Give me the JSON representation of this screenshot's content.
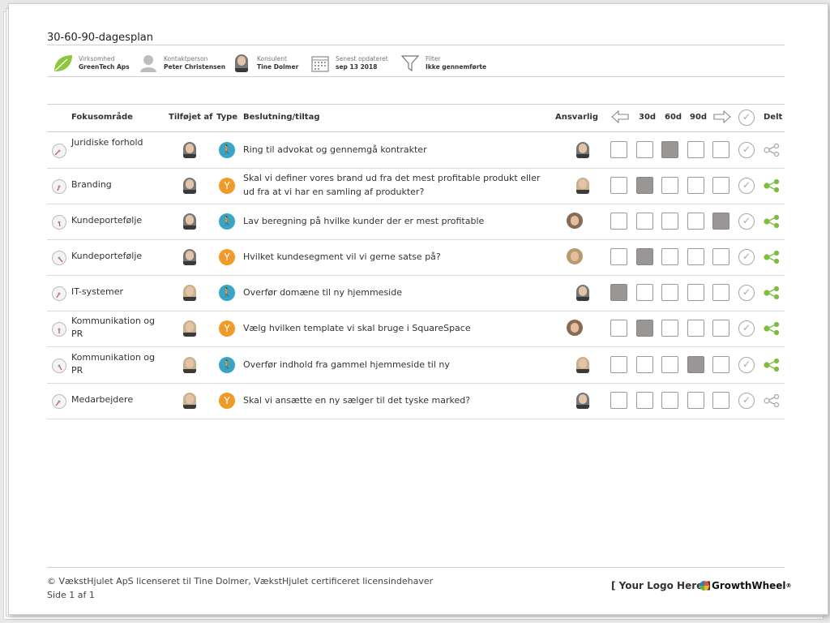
{
  "title": "30-60-90-dagesplan",
  "info": {
    "company": {
      "label": "Virksomhed",
      "value": "GreenTech Aps"
    },
    "contact": {
      "label": "Kontaktperson",
      "value": "Peter Christensen"
    },
    "consultant": {
      "label": "Konsulent",
      "value": "Tine Dolmer"
    },
    "updated": {
      "label": "Senest opdateret",
      "value": "sep 13 2018"
    },
    "filter": {
      "label": "Filter",
      "value": "Ikke gennemførte"
    }
  },
  "headers": {
    "focus": "Fokusområde",
    "added_by": "Tilføjet af",
    "type": "Type",
    "decision": "Beslutning/tiltag",
    "responsible": "Ansvarlig",
    "d30": "30d",
    "d60": "60d",
    "d90": "90d",
    "shared": "Delt"
  },
  "rows": [
    {
      "focus": "Juridiske forhold",
      "type": "action",
      "decision": "Ring til advokat og gennemgå kontrakter",
      "active": 2,
      "shared": false
    },
    {
      "focus": "Branding",
      "type": "decision",
      "decision": "Skal vi definer vores brand ud fra det mest profitable produkt eller ud fra at vi har en samling af produkter?",
      "active": 1,
      "shared": true
    },
    {
      "focus": "Kundeportefølje",
      "type": "action",
      "decision": "Lav beregning på hvilke kunder der er mest profitable",
      "active": 4,
      "shared": true
    },
    {
      "focus": "Kundeportefølje",
      "type": "decision",
      "decision": "Hvilket kundesegment vil vi gerne satse på?",
      "active": 1,
      "shared": true
    },
    {
      "focus": "IT-systemer",
      "type": "action",
      "decision": "Overfør domæne til ny hjemmeside",
      "active": 0,
      "shared": true
    },
    {
      "focus": "Kommunikation og PR",
      "type": "decision",
      "decision": "Vælg hvilken template vi skal bruge i SquareSpace",
      "active": 1,
      "shared": true
    },
    {
      "focus": "Kommunikation og PR",
      "type": "action",
      "decision": "Overfør indhold fra gammel hjemmeside til ny",
      "active": 3,
      "shared": true
    },
    {
      "focus": "Medarbejdere",
      "type": "decision",
      "decision": "Skal vi ansætte en ny sælger til det tyske marked?",
      "active": -1,
      "shared": false
    }
  ],
  "footer": {
    "copyright": "© VækstHjulet ApS licenseret til Tine Dolmer, VækstHjulet certificeret licensindehaver",
    "page": "Side 1 af 1",
    "logo_placeholder": "[ Your Logo Here ]",
    "brand": "GrowthWheel",
    "brand_mark": "®"
  },
  "colors": {
    "action": "#3aa4c4",
    "decision": "#f09a2a",
    "shared_on": "#7cbf3f",
    "shared_off": "#a8a8a8",
    "box_on": "#9b9696"
  }
}
